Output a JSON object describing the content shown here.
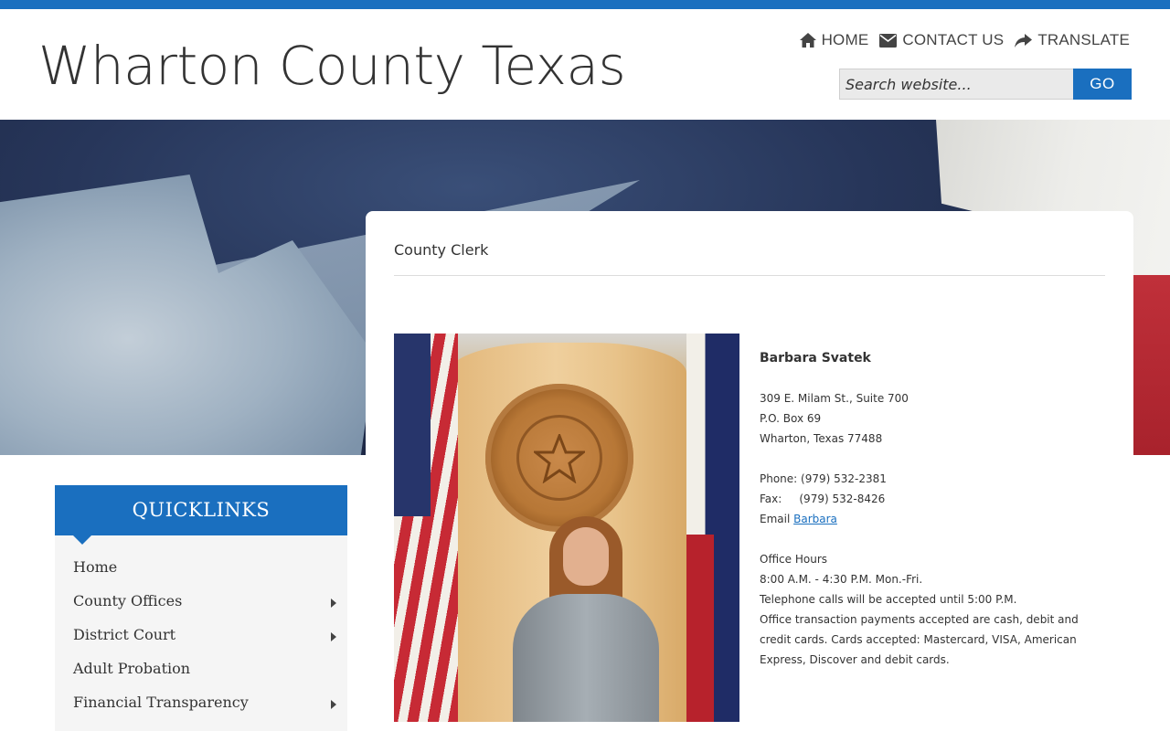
{
  "site": {
    "title": "Wharton County Texas"
  },
  "topnav": [
    {
      "label": "HOME",
      "icon": "home-icon"
    },
    {
      "label": "CONTACT US",
      "icon": "envelope-icon"
    },
    {
      "label": "TRANSLATE",
      "icon": "share-icon"
    }
  ],
  "search": {
    "placeholder": "Search website...",
    "button": "GO"
  },
  "colors": {
    "brand_blue": "#1a6fbf",
    "text": "#333333",
    "sidebar_bg": "#f5f5f5"
  },
  "page": {
    "title": "County Clerk"
  },
  "clerk": {
    "name": "Barbara Svatek",
    "address": [
      "309 E. Milam St., Suite 700",
      "P.O. Box 69",
      "Wharton, Texas 77488"
    ],
    "phone": "Phone: (979) 532-2381",
    "fax": "Fax:     (979) 532-8426",
    "email_label": "Email ",
    "email_link": "Barbara",
    "hours": [
      "Office Hours",
      "8:00 A.M. - 4:30 P.M. Mon.-Fri.",
      "Telephone calls will be accepted until 5:00 P.M.",
      "Office transaction payments accepted are cash, debit and credit cards. Cards accepted:  Mastercard, VISA, American Express, Discover and debit cards."
    ]
  },
  "quicklinks": {
    "title": "QUICKLINKS",
    "items": [
      {
        "label": "Home",
        "has_submenu": false
      },
      {
        "label": "County Offices",
        "has_submenu": true
      },
      {
        "label": "District Court",
        "has_submenu": true
      },
      {
        "label": "Adult Probation",
        "has_submenu": false
      },
      {
        "label": "Financial Transparency",
        "has_submenu": true
      }
    ]
  }
}
